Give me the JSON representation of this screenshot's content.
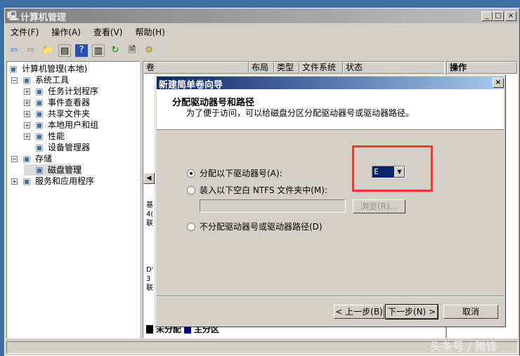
{
  "window": {
    "title": "计算机管理",
    "controls": [
      "_",
      "□",
      "×"
    ]
  },
  "menu": [
    "文件(F)",
    "操作(A)",
    "查看(V)",
    "帮助(H)"
  ],
  "tree": [
    {
      "label": "计算机管理(本地)",
      "icon": "computer-icon",
      "level": 0,
      "expander": ""
    },
    {
      "label": "系统工具",
      "icon": "tools-icon",
      "level": 1,
      "expander": "−"
    },
    {
      "label": "任务计划程序",
      "icon": "clock-icon",
      "level": 2,
      "expander": "+"
    },
    {
      "label": "事件查看器",
      "icon": "event-viewer-icon",
      "level": 2,
      "expander": "+"
    },
    {
      "label": "共享文件夹",
      "icon": "shared-folder-icon",
      "level": 2,
      "expander": "+"
    },
    {
      "label": "本地用户和组",
      "icon": "users-icon",
      "level": 2,
      "expander": "+"
    },
    {
      "label": "性能",
      "icon": "performance-icon",
      "level": 2,
      "expander": "+"
    },
    {
      "label": "设备管理器",
      "icon": "device-manager-icon",
      "level": 2,
      "expander": ""
    },
    {
      "label": "存储",
      "icon": "storage-icon",
      "level": 1,
      "expander": "−"
    },
    {
      "label": "磁盘管理",
      "icon": "disk-icon",
      "level": 2,
      "expander": "",
      "selected": true
    },
    {
      "label": "服务和应用程序",
      "icon": "services-icon",
      "level": 1,
      "expander": "+"
    }
  ],
  "columns": [
    "卷",
    "布局",
    "类型",
    "文件系统",
    "状态"
  ],
  "actions_header": "操作",
  "disk_side": [
    "基",
    "4(",
    "联",
    "D'",
    "3",
    "联"
  ],
  "legend": [
    {
      "label": "未分配",
      "color": "#000000"
    },
    {
      "label": "主分区",
      "color": "#000080"
    }
  ],
  "dialog": {
    "title": "新建简单卷向导",
    "heading": "分配驱动器号和路径",
    "subheading": "为了便于访问，可以给磁盘分区分配驱动器号或驱动器路径。",
    "options": [
      "分配以下驱动器号(A):",
      "装入以下空白 NTFS 文件夹中(M):",
      "不分配驱动器号或驱动器路径(D)"
    ],
    "selected_option": 0,
    "drive_letter": "E",
    "folder_path": "",
    "browse": "浏览(R)...",
    "back": "< 上一步(B)",
    "next": "下一步(N) >",
    "cancel": "取消"
  },
  "watermark": "头条号 / 腾锋",
  "colors": {
    "highlight": "#ff3333",
    "title_active": "#0a246a"
  }
}
